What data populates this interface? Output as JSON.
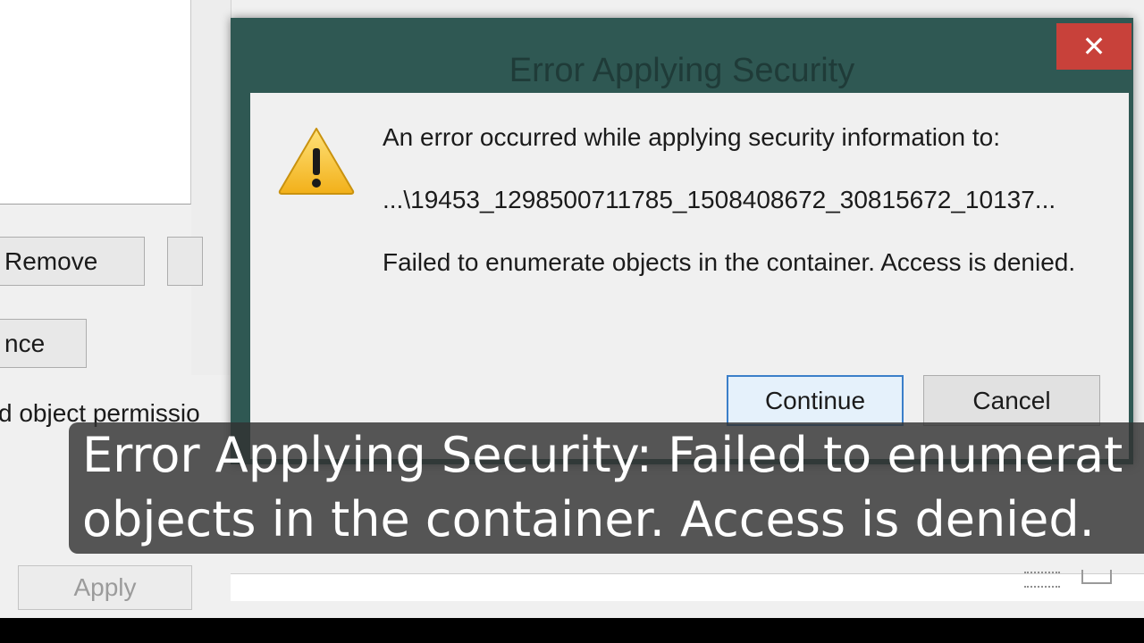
{
  "background_window": {
    "remove_label": "Remove",
    "advance_label": "nce",
    "description_text": "d object permissio",
    "apply_label": "Apply"
  },
  "dialog": {
    "title": "Error Applying Security",
    "close_glyph": "✕",
    "message_line1": "An error occurred while applying security information to:",
    "path": "...\\19453_1298500711785_1508408672_30815672_10137...",
    "message_line2": "Failed to enumerate objects in the container. Access is denied.",
    "continue_label": "Continue",
    "cancel_label": "Cancel",
    "icon": "warning-icon"
  },
  "caption": {
    "line1": "Error Applying Security: Failed to enumerat",
    "line2": "objects in the container. Access is denied."
  },
  "colors": {
    "dialog_frame": "#2f5853",
    "close_button": "#c8413a",
    "default_button_border": "#3b7fc9"
  }
}
